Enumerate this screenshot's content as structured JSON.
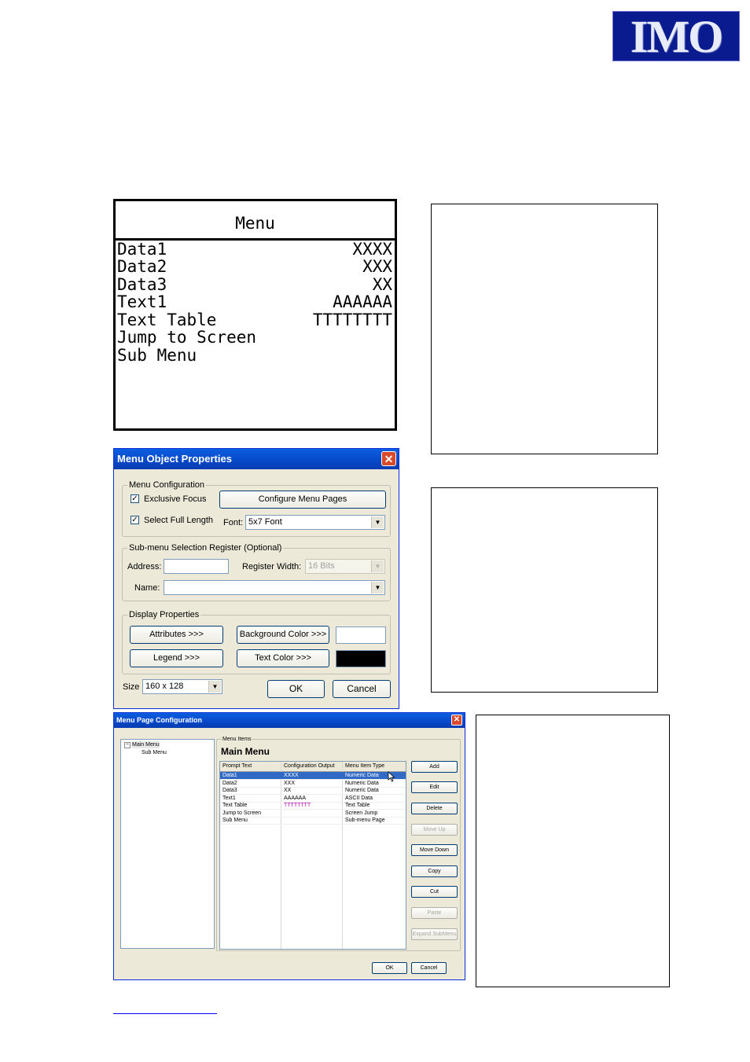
{
  "logo": {
    "text": "IMO"
  },
  "lcd": {
    "title": "Menu",
    "rows": [
      {
        "label": "Data1",
        "value": "XXXX"
      },
      {
        "label": "Data2",
        "value": "XXX"
      },
      {
        "label": "Data3",
        "value": "XX"
      },
      {
        "label": "Text1",
        "value": "AAAAAA"
      },
      {
        "label": "Text Table",
        "value": "TTTTTTTT"
      },
      {
        "label": "Jump to Screen",
        "value": ""
      },
      {
        "label": "Sub Menu",
        "value": ""
      }
    ]
  },
  "menu_object_properties": {
    "title": "Menu Object Properties",
    "close": "✕",
    "menu_configuration": {
      "label": "Menu Configuration",
      "exclusive_focus": {
        "label": "Exclusive Focus",
        "checked": true
      },
      "configure_pages_button": "Configure Menu Pages",
      "select_full_length": {
        "label": "Select Full Length",
        "checked": true
      },
      "font_label": "Font:",
      "font_value": "5x7 Font"
    },
    "submenu_register": {
      "label": "Sub-menu Selection Register (Optional)",
      "address_label": "Address:",
      "address_value": "",
      "register_width_label": "Register Width:",
      "register_width_value": "16 Bits",
      "name_label": "Name:",
      "name_value": ""
    },
    "display_properties": {
      "label": "Display Properties",
      "attributes_button": "Attributes >>>",
      "background_color_button": "Background Color >>>",
      "background_color": "#ffffff",
      "legend_button": "Legend >>>",
      "text_color_button": "Text Color >>>",
      "text_color": "#000000"
    },
    "size_label": "Size",
    "size_value": "160 x 128",
    "ok_button": "OK",
    "cancel_button": "Cancel"
  },
  "menu_page_configuration": {
    "title": "Menu Page Configuration",
    "close": "✕",
    "tree": {
      "root": "Main Menu",
      "child": "Sub Menu",
      "expander": "−"
    },
    "menu_items_label": "Menu Items",
    "page_title": "Main Menu",
    "columns": [
      "Prompt Text",
      "Configuration Output",
      "Menu Item Type"
    ],
    "rows": [
      {
        "prompt": "Data1",
        "output": "XXXX",
        "type": "Numeric Data",
        "selected": true
      },
      {
        "prompt": "Data2",
        "output": "XXX",
        "type": "Numeric Data"
      },
      {
        "prompt": "Data3",
        "output": "XX",
        "type": "Numeric Data"
      },
      {
        "prompt": "Text1",
        "output": "AAAAAA",
        "type": "ASCII Data"
      },
      {
        "prompt": "Text Table",
        "output": "TTTTTTTT",
        "type": "Text Table"
      },
      {
        "prompt": "Jump to Screen",
        "output": "",
        "type": "Screen Jump"
      },
      {
        "prompt": "Sub Menu",
        "output": "",
        "type": "Sub-menu Page"
      }
    ],
    "buttons": {
      "add": "Add",
      "edit": "Edit",
      "delete": "Delete",
      "move_up": "Move Up",
      "move_down": "Move Down",
      "copy": "Copy",
      "cut": "Cut",
      "paste": "Paste",
      "expand_submenu": "Expand SubMenu"
    },
    "ok_button": "OK",
    "cancel_button": "Cancel"
  }
}
